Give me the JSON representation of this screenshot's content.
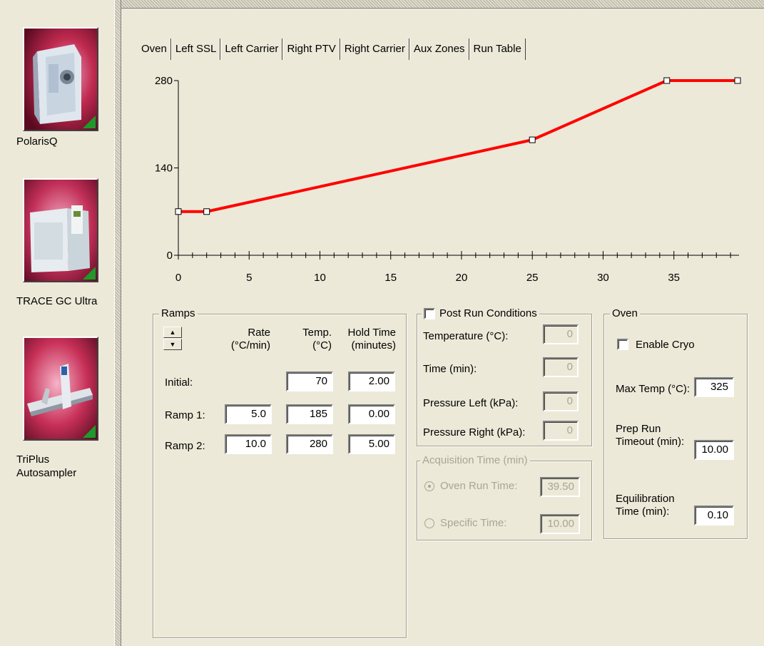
{
  "sidebar": {
    "instruments": [
      {
        "label_lines": [
          "PolarisQ"
        ]
      },
      {
        "label_lines": [
          "TRACE GC Ultra"
        ]
      },
      {
        "label_lines": [
          "TriPlus",
          "Autosampler"
        ]
      }
    ]
  },
  "tabs": [
    "Oven",
    "Left SSL",
    "Left Carrier",
    "Right PTV",
    "Right Carrier",
    "Aux Zones",
    "Run Table"
  ],
  "active_tab": "Oven",
  "chart_data": {
    "type": "line",
    "title": "",
    "xlabel": "",
    "ylabel": "",
    "x": [
      0,
      2,
      25,
      34.5,
      39.5
    ],
    "values": [
      70,
      70,
      185,
      280,
      280
    ],
    "xlim": [
      0,
      39.5
    ],
    "ylim": [
      0,
      280
    ],
    "x_ticks": [
      0,
      5,
      10,
      15,
      20,
      25,
      30,
      35
    ],
    "y_ticks": [
      0,
      140,
      280
    ],
    "color": "#ff0000",
    "grid": false
  },
  "ramps": {
    "title": "Ramps",
    "col_rate": [
      "Rate",
      "(°C/min)"
    ],
    "col_temp": [
      "Temp.",
      "(°C)"
    ],
    "col_hold": [
      "Hold Time",
      "(minutes)"
    ],
    "spin_up": "▲",
    "spin_down": "▼",
    "rows": [
      {
        "label": "Initial:",
        "rate": "",
        "temp": "70",
        "hold": "2.00"
      },
      {
        "label": "Ramp 1:",
        "rate": "5.0",
        "temp": "185",
        "hold": "0.00"
      },
      {
        "label": "Ramp 2:",
        "rate": "10.0",
        "temp": "280",
        "hold": "5.00"
      }
    ]
  },
  "post_run": {
    "title": "Post Run Conditions",
    "checked": false,
    "fields": [
      {
        "label": "Temperature (°C):",
        "value": "0"
      },
      {
        "label": "Time (min):",
        "value": "0"
      },
      {
        "label": "Pressure Left (kPa):",
        "value": "0"
      },
      {
        "label": "Pressure Right (kPa):",
        "value": "0"
      }
    ]
  },
  "acquisition": {
    "title": "Acquisition Time (min)",
    "oven_run_time_label": "Oven Run Time:",
    "oven_run_time_value": "39.50",
    "specific_time_label": "Specific Time:",
    "specific_time_value": "10.00",
    "selected": "oven"
  },
  "oven": {
    "title": "Oven",
    "enable_cryo_label": "Enable Cryo",
    "enable_cryo_checked": false,
    "max_temp_label": "Max Temp (°C):",
    "max_temp_value": "325",
    "prep_run_label": [
      "Prep Run",
      "Timeout (min):"
    ],
    "prep_run_value": "10.00",
    "equilibration_label": [
      "Equilibration",
      "Time (min):"
    ],
    "equilibration_value": "0.10"
  }
}
